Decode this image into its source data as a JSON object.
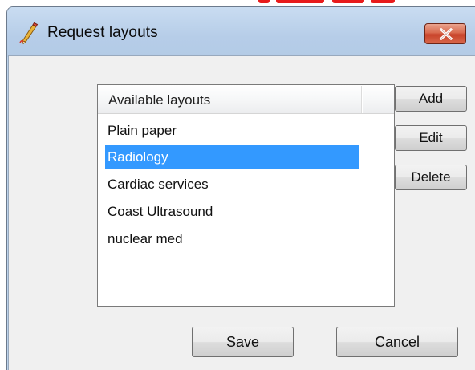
{
  "window": {
    "title": "Request layouts",
    "title_icon": "pencil-icon",
    "close_icon": "close-icon"
  },
  "list": {
    "header": "Available layouts",
    "items": [
      {
        "label": "Plain paper",
        "selected": false
      },
      {
        "label": "Radiology",
        "selected": true
      },
      {
        "label": "Cardiac services",
        "selected": false
      },
      {
        "label": "Coast Ultrasound",
        "selected": false
      },
      {
        "label": "nuclear med",
        "selected": false
      }
    ]
  },
  "side_buttons": {
    "add": "Add",
    "edit": "Edit",
    "delete": "Delete"
  },
  "bottom_buttons": {
    "save": "Save",
    "cancel": "Cancel"
  },
  "colors": {
    "selection": "#3399ff",
    "titlebar": "#b9d1ea",
    "close_button": "#c8432a",
    "dialog_background": "#f0f0f0"
  }
}
